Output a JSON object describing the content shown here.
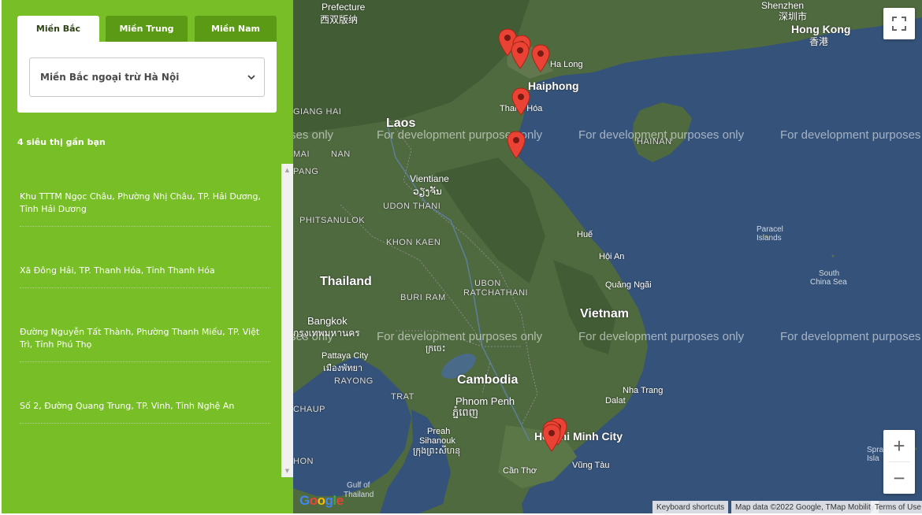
{
  "tabs": [
    {
      "label": "Miền Bắc",
      "active": true
    },
    {
      "label": "Miền Trung",
      "active": false
    },
    {
      "label": "Miền Nam",
      "active": false
    }
  ],
  "filter": {
    "selected": "Miền Bắc ngoại trừ Hà Nội"
  },
  "results": {
    "count_label": "4 siêu thị gần bạn"
  },
  "stores": [
    {
      "address": "Khu TTTM Ngọc Châu, Phường Nhị Châu, TP. Hải Dương, Tỉnh Hải Dương"
    },
    {
      "address": "Xã Đông Hải, TP. Thanh Hóa, Tỉnh Thanh Hóa"
    },
    {
      "address": "Đường Nguyễn Tất Thành, Phường Thanh Miếu, TP. Việt Trì, Tỉnh Phú Thọ"
    },
    {
      "address": "Số 2, Đường Quang Trung, TP. Vinh, Tỉnh Nghệ An"
    }
  ],
  "map": {
    "watermark": "For development purposes only",
    "watermark_partial": "ses only",
    "labels": {
      "prefecture": "Prefecture",
      "xishuangbanna": "西双版纳",
      "shenzhen": "Shenzhen",
      "shenzhen_cn": "深圳市",
      "hongkong": "Hong Kong",
      "hongkong_cn": "香港",
      "laos": "Laos",
      "vientiane": "Vientiane",
      "vientiane_lo": "ວຽງຈັນ",
      "udon": "UDON THANI",
      "phitsanulok": "PHITSANULOK",
      "khonkaen": "KHON KAEN",
      "thailand": "Thailand",
      "ubon": "UBON",
      "ubon2": "RATCHATHANI",
      "buriram": "BURI RAM",
      "bangkok": "Bangkok",
      "bangkok_th": "กรุงเทพมหานคร",
      "pattaya": "Pattaya City",
      "pattaya_th": "เมืองพัทยา",
      "rayong": "RAYONG",
      "trat": "TRAT",
      "cambodia": "Cambodia",
      "phnompenh": "Phnom Penh",
      "phnompenh_km": "ភ្នំពេញ",
      "kratie_km": "ក្រចេះ",
      "preah": "Preah",
      "sihanouk": "Sihanouk",
      "sihanouk_km": "ក្រុងព្រះសីហនុ",
      "chaup": "CHAUP",
      "hon": "HON",
      "gulf": "Gulf of",
      "gulf2": "Thailand",
      "vietnam": "Vietnam",
      "haiphong": "Haiphong",
      "halong": "Ha Long",
      "hanoi": "Hà",
      "thanhhoa": "Thanh Hóa",
      "hainan": "HAINAN",
      "hue": "Huế",
      "hoian": "Hội An",
      "quangngai": "Quảng Ngãi",
      "nhatrang": "Nha Trang",
      "dalat": "Dalat",
      "hcm": "Ho Chi Minh City",
      "cantho": "Cần Thơ",
      "vungtau": "Vũng Tàu",
      "paracel": "Paracel",
      "paracel2": "Islands",
      "southchina": "South",
      "southchina2": "China Sea",
      "spratly": "Spra",
      "spratly2": "Isla",
      "mai": "MAI",
      "nan": "NAN",
      "pang": "PANG",
      "giang": "GIANG HAI",
      "khmer_kr": "ក្រចេះ"
    },
    "google_logo": "Google",
    "attribution": {
      "shortcuts": "Keyboard shortcuts",
      "data": "Map data ©2022 Google, TMap Mobility",
      "terms": "Terms of Use"
    },
    "controls": {
      "zoom_in": "+",
      "zoom_out": "−"
    }
  }
}
